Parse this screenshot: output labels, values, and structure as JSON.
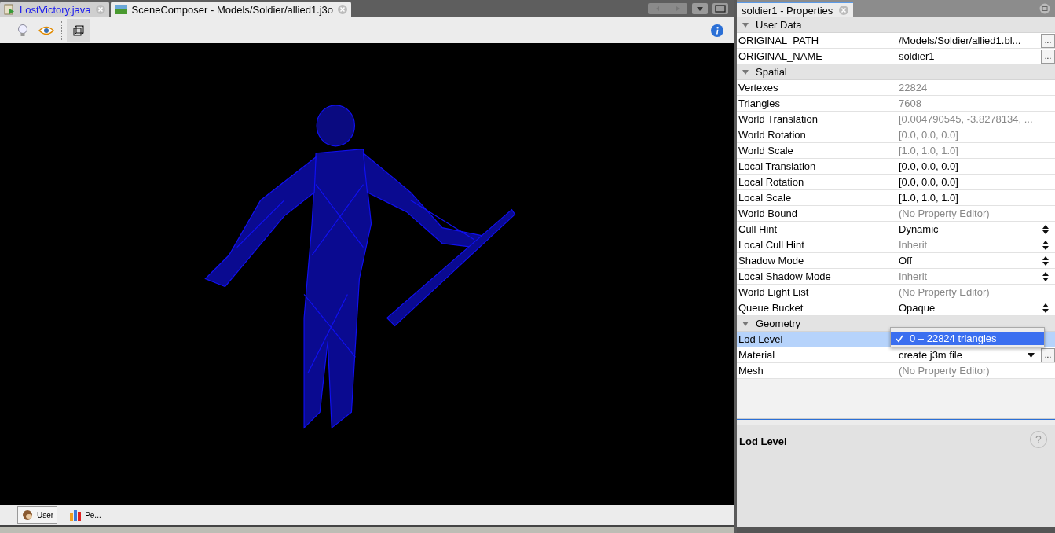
{
  "editor_tabs": [
    {
      "label": "LostVictory.java",
      "kind": "java",
      "selected": false
    },
    {
      "label": "SceneComposer - Models/Soldier/allied1.j3o",
      "kind": "scene",
      "selected": true
    }
  ],
  "toolbar": [
    {
      "kind": "bulb",
      "selected": false
    },
    {
      "kind": "eye",
      "selected": false
    },
    {
      "kind": "cube",
      "selected": true
    }
  ],
  "bottom_toolbar": [
    {
      "label": "User",
      "kind": "user",
      "selected": true
    },
    {
      "label": "Pe...",
      "kind": "chart",
      "selected": false
    }
  ],
  "properties_tab": {
    "label": "soldier1 - Properties"
  },
  "sections": [
    {
      "title": "User Data",
      "expanded": true,
      "rows": [
        {
          "name": "ORIGINAL_PATH",
          "value": "/Models/Soldier/allied1.bl...",
          "kind": "text",
          "button": "..."
        },
        {
          "name": "ORIGINAL_NAME",
          "value": "soldier1",
          "kind": "text",
          "button": "..."
        }
      ]
    },
    {
      "title": "Spatial",
      "expanded": true,
      "rows": [
        {
          "name": "Vertexes",
          "value": "22824",
          "kind": "readonly"
        },
        {
          "name": "Triangles",
          "value": "7608",
          "kind": "readonly"
        },
        {
          "name": "World Translation",
          "value": "[0.004790545, -3.8278134, ...",
          "kind": "readonly"
        },
        {
          "name": "World Rotation",
          "value": "[0.0, 0.0, 0.0]",
          "kind": "readonly"
        },
        {
          "name": "World Scale",
          "value": "[1.0, 1.0, 1.0]",
          "kind": "readonly"
        },
        {
          "name": "Local Translation",
          "value": "[0.0, 0.0, 0.0]",
          "kind": "text"
        },
        {
          "name": "Local Rotation",
          "value": "[0.0, 0.0, 0.0]",
          "kind": "text"
        },
        {
          "name": "Local Scale",
          "value": "[1.0, 1.0, 1.0]",
          "kind": "text"
        },
        {
          "name": "World Bound",
          "value": "(No Property Editor)",
          "kind": "noeditor"
        },
        {
          "name": "Cull Hint",
          "value": "Dynamic",
          "kind": "combo"
        },
        {
          "name": "Local Cull Hint",
          "value": "Inherit",
          "kind": "combo-readonly"
        },
        {
          "name": "Shadow Mode",
          "value": "Off",
          "kind": "combo"
        },
        {
          "name": "Local Shadow Mode",
          "value": "Inherit",
          "kind": "combo-readonly"
        },
        {
          "name": "World Light List",
          "value": "(No Property Editor)",
          "kind": "noeditor"
        },
        {
          "name": "Queue Bucket",
          "value": "Opaque",
          "kind": "combo"
        }
      ]
    },
    {
      "title": "Geometry",
      "expanded": true,
      "rows": [
        {
          "name": "Lod Level",
          "kind": "popup",
          "selected": true
        },
        {
          "name": "Material",
          "value": "create j3m file",
          "kind": "dropdown",
          "button": "..."
        },
        {
          "name": "Mesh",
          "value": "(No Property Editor)",
          "kind": "noeditor"
        }
      ]
    }
  ],
  "lod_popup": {
    "items": [
      {
        "label": "0 – 22824 triangles",
        "selected": true
      }
    ]
  },
  "description": {
    "title": "Lod Level",
    "help": "?"
  }
}
